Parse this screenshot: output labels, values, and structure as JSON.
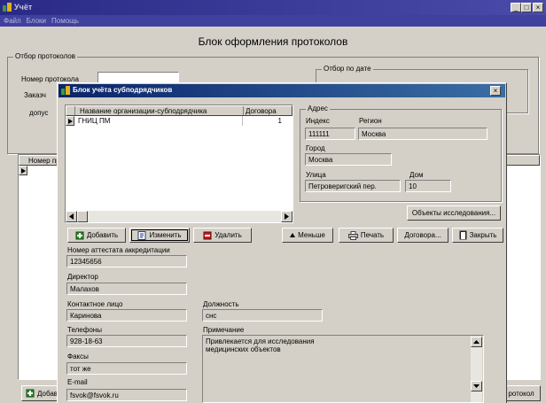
{
  "main_window": {
    "title": "Учёт",
    "menu": [
      "Файл",
      "Блоки",
      "Помощь"
    ],
    "heading": "Блок оформления протоколов",
    "filter_group": "Отбор протоколов",
    "protocol_number_label": "Номер протокола",
    "customer_label": "Заказч",
    "admitted_label": "допус",
    "date_filter_group": "Отбор по дате",
    "grid_header_left": "Номер пр",
    "add_button": "Добав",
    "protocol_button": "ротокол"
  },
  "dialog": {
    "title": "Блок учёта субподрядчиков",
    "table": {
      "columns": [
        "Название организации-субподрядчика",
        "Договора"
      ],
      "rows": [
        {
          "name": "ГНИЦ ПМ",
          "contracts": "1"
        }
      ]
    },
    "address": {
      "group": "Адрес",
      "index_label": "Индекс",
      "index_value": "111111",
      "region_label": "Регион",
      "region_value": "Москва",
      "city_label": "Город",
      "city_value": "Москва",
      "street_label": "Улица",
      "street_value": "Петроверигский пер.",
      "house_label": "Дом",
      "house_value": "10"
    },
    "objects_button": "Объекты исследования...",
    "buttons": {
      "add": "Добавить",
      "edit": "Изменить",
      "delete": "Удалить",
      "less": "Меньше",
      "print": "Печать",
      "contract": "Договора...",
      "close": "Закрыть"
    },
    "fields": {
      "certificate_label": "Номер аттестата аккредитации",
      "certificate_value": "12345656",
      "director_label": "Директор",
      "director_value": "Малахов",
      "contact_label": "Контактное лицо",
      "contact_value": "Каринова",
      "position_label": "Должность",
      "position_value": "снс",
      "phones_label": "Телефоны",
      "phones_value": "928-18-63",
      "fax_label": "Факсы",
      "fax_value": "тот же",
      "email_label": "E-mail",
      "email_value": "fsvok@fsvok.ru",
      "note_label": "Примечание",
      "note_line1": "Привлекается для исследования",
      "note_line2": "медицинских объектов"
    }
  },
  "colors": {
    "title_active": "#0a246a",
    "title_inactive": "#808080",
    "face": "#d4d0c8"
  }
}
